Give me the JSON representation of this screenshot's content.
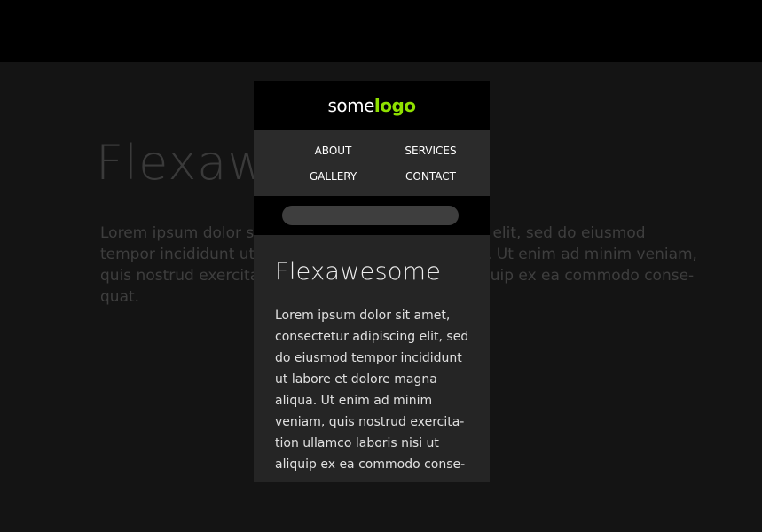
{
  "background": {
    "title": "Flexawesome",
    "text_lines": [
      "Lorem ipsum dolor sit amet, consectetur adipiscing elit, sed do eiusmod",
      "tempor incididunt ut labore et dolore magna aliqua. Ut enim ad minim veniam,",
      "quis nostrud exercitation ullamco laboris nisi ut aliquip ex ea commodo conse-",
      "quat."
    ]
  },
  "phone": {
    "logo": {
      "regular": "some",
      "bold": "logo"
    },
    "nav": [
      {
        "label": "ABOUT"
      },
      {
        "label": "SERVICES"
      },
      {
        "label": "GALLERY"
      },
      {
        "label": "CONTACT"
      }
    ],
    "search": {
      "placeholder": "",
      "value": "",
      "icon": "search-icon"
    },
    "content": {
      "title": "Flexawesome",
      "text_lines": [
        "Lorem ipsum dolor sit amet,",
        "consectetur adipiscing elit, sed",
        "do eiusmod tempor incididunt",
        "ut labore et dolore magna",
        "aliqua. Ut enim ad minim",
        "veniam, quis nostrud exercita-",
        "tion ullamco laboris nisi ut",
        "aliquip ex ea commodo conse-"
      ]
    }
  },
  "colors": {
    "accent": "#8fe000",
    "background": "#141414",
    "header": "#000000",
    "panel": "#252525"
  }
}
